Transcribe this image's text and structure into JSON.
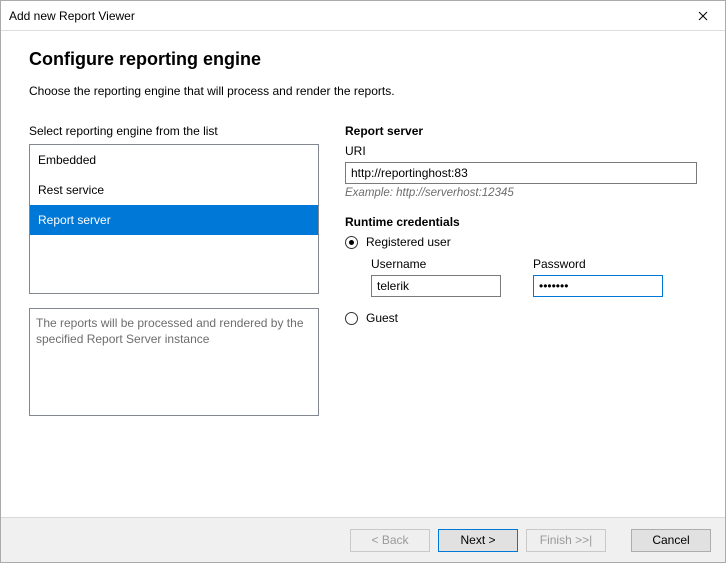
{
  "window": {
    "title": "Add new Report Viewer"
  },
  "page": {
    "heading": "Configure reporting engine",
    "subtitle": "Choose the reporting engine that will process and render the reports."
  },
  "left": {
    "list_label": "Select reporting engine from the list",
    "items": [
      "Embedded",
      "Rest service",
      "Report server"
    ],
    "selected_index": 2,
    "description": "The reports will be processed and rendered by the specified Report Server instance"
  },
  "right": {
    "server_label": "Report server",
    "uri_label": "URI",
    "uri_value": "http://reportinghost:83",
    "uri_hint": "Example: http://serverhost:12345",
    "runtime_label": "Runtime credentials",
    "radio_registered": "Registered user",
    "radio_guest": "Guest",
    "selected_radio": "registered",
    "username_label": "Username",
    "username_value": "telerik",
    "password_label": "Password",
    "password_value": "•••••••"
  },
  "buttons": {
    "back": "< Back",
    "next": "Next >",
    "finish": "Finish >>|",
    "cancel": "Cancel"
  }
}
